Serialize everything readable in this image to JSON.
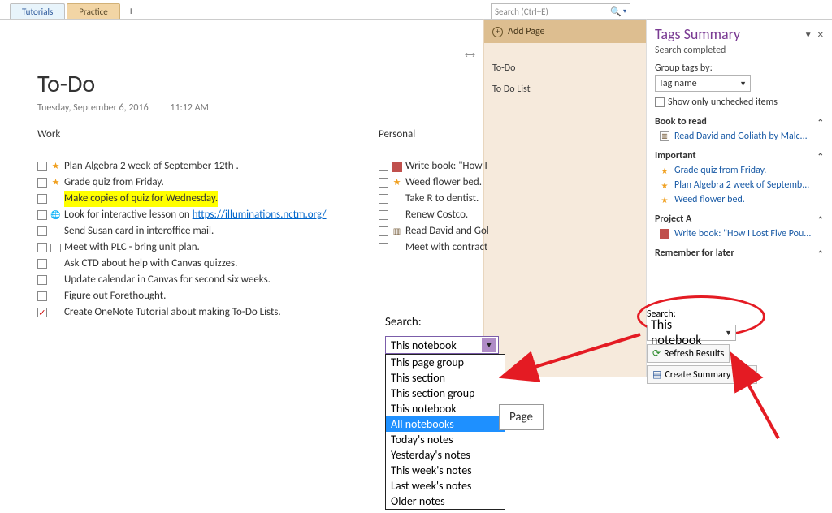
{
  "tabs": {
    "t0": "Tutorials",
    "t1": "Practice"
  },
  "searchbox": {
    "placeholder": "Search (Ctrl+E)"
  },
  "page": {
    "title": "To-Do",
    "date": "Tuesday, September 6, 2016",
    "time": "11:12 AM",
    "h_work": "Work",
    "h_personal": "Personal"
  },
  "work": {
    "i0": "Plan Algebra 2 week of September 12th .",
    "i1": "Grade quiz from Friday.",
    "i2": "Make copies of quiz for Wednesday.",
    "i3_pre": "Look for interactive lesson on ",
    "i3_link": "https://illuminations.nctm.org/",
    "i4": "Send Susan card in interoffice mail.",
    "i5": "Meet with PLC - bring unit plan.",
    "i6": "Ask CTD about help with Canvas quizzes.",
    "i7": "Update calendar in Canvas for second six weeks.",
    "i8": "Figure out Forethought.",
    "i9": "Create OneNote Tutorial about making To-Do Lists."
  },
  "pers": {
    "i0": "Write book: \"How I",
    "i1": "Weed flower bed.",
    "i2": "Take R to dentist.",
    "i3": "Renew Costco.",
    "i4": "Read David and Gol",
    "i5": "Meet with contract"
  },
  "pagelist": {
    "add": "Add Page",
    "p0": "To-Do",
    "p1": "To Do List"
  },
  "tags": {
    "title": "Tags Summary",
    "completed": "Search completed",
    "groupby_lbl": "Group tags by:",
    "groupby_val": "Tag name",
    "unchecked": "Show only unchecked items",
    "g_book": "Book to read",
    "book_i0": "Read David and Goliath by Malc...",
    "g_imp": "Important",
    "imp_i0": "Grade quiz from Friday.",
    "imp_i1": "Plan Algebra 2 week of Septemb...",
    "imp_i2": "Weed flower bed.",
    "g_proj": "Project A",
    "proj_i0": "Write book: \"How I Lost Five Pou...",
    "g_rem": "Remember for later",
    "search_lbl": "Search:",
    "search_val": "This notebook",
    "refresh": "Refresh Results",
    "summary": "Create Summary Page"
  },
  "dropdown": {
    "label": "Search:",
    "value": "This notebook",
    "o0": "This page group",
    "o1": "This section",
    "o2": "This section group",
    "o3": "This notebook",
    "o4": "All notebooks",
    "o5": "Today's notes",
    "o6": "Yesterday's notes",
    "o7": "This week's notes",
    "o8": "Last week's notes",
    "o9": "Older notes"
  },
  "pagebtn": "Page"
}
